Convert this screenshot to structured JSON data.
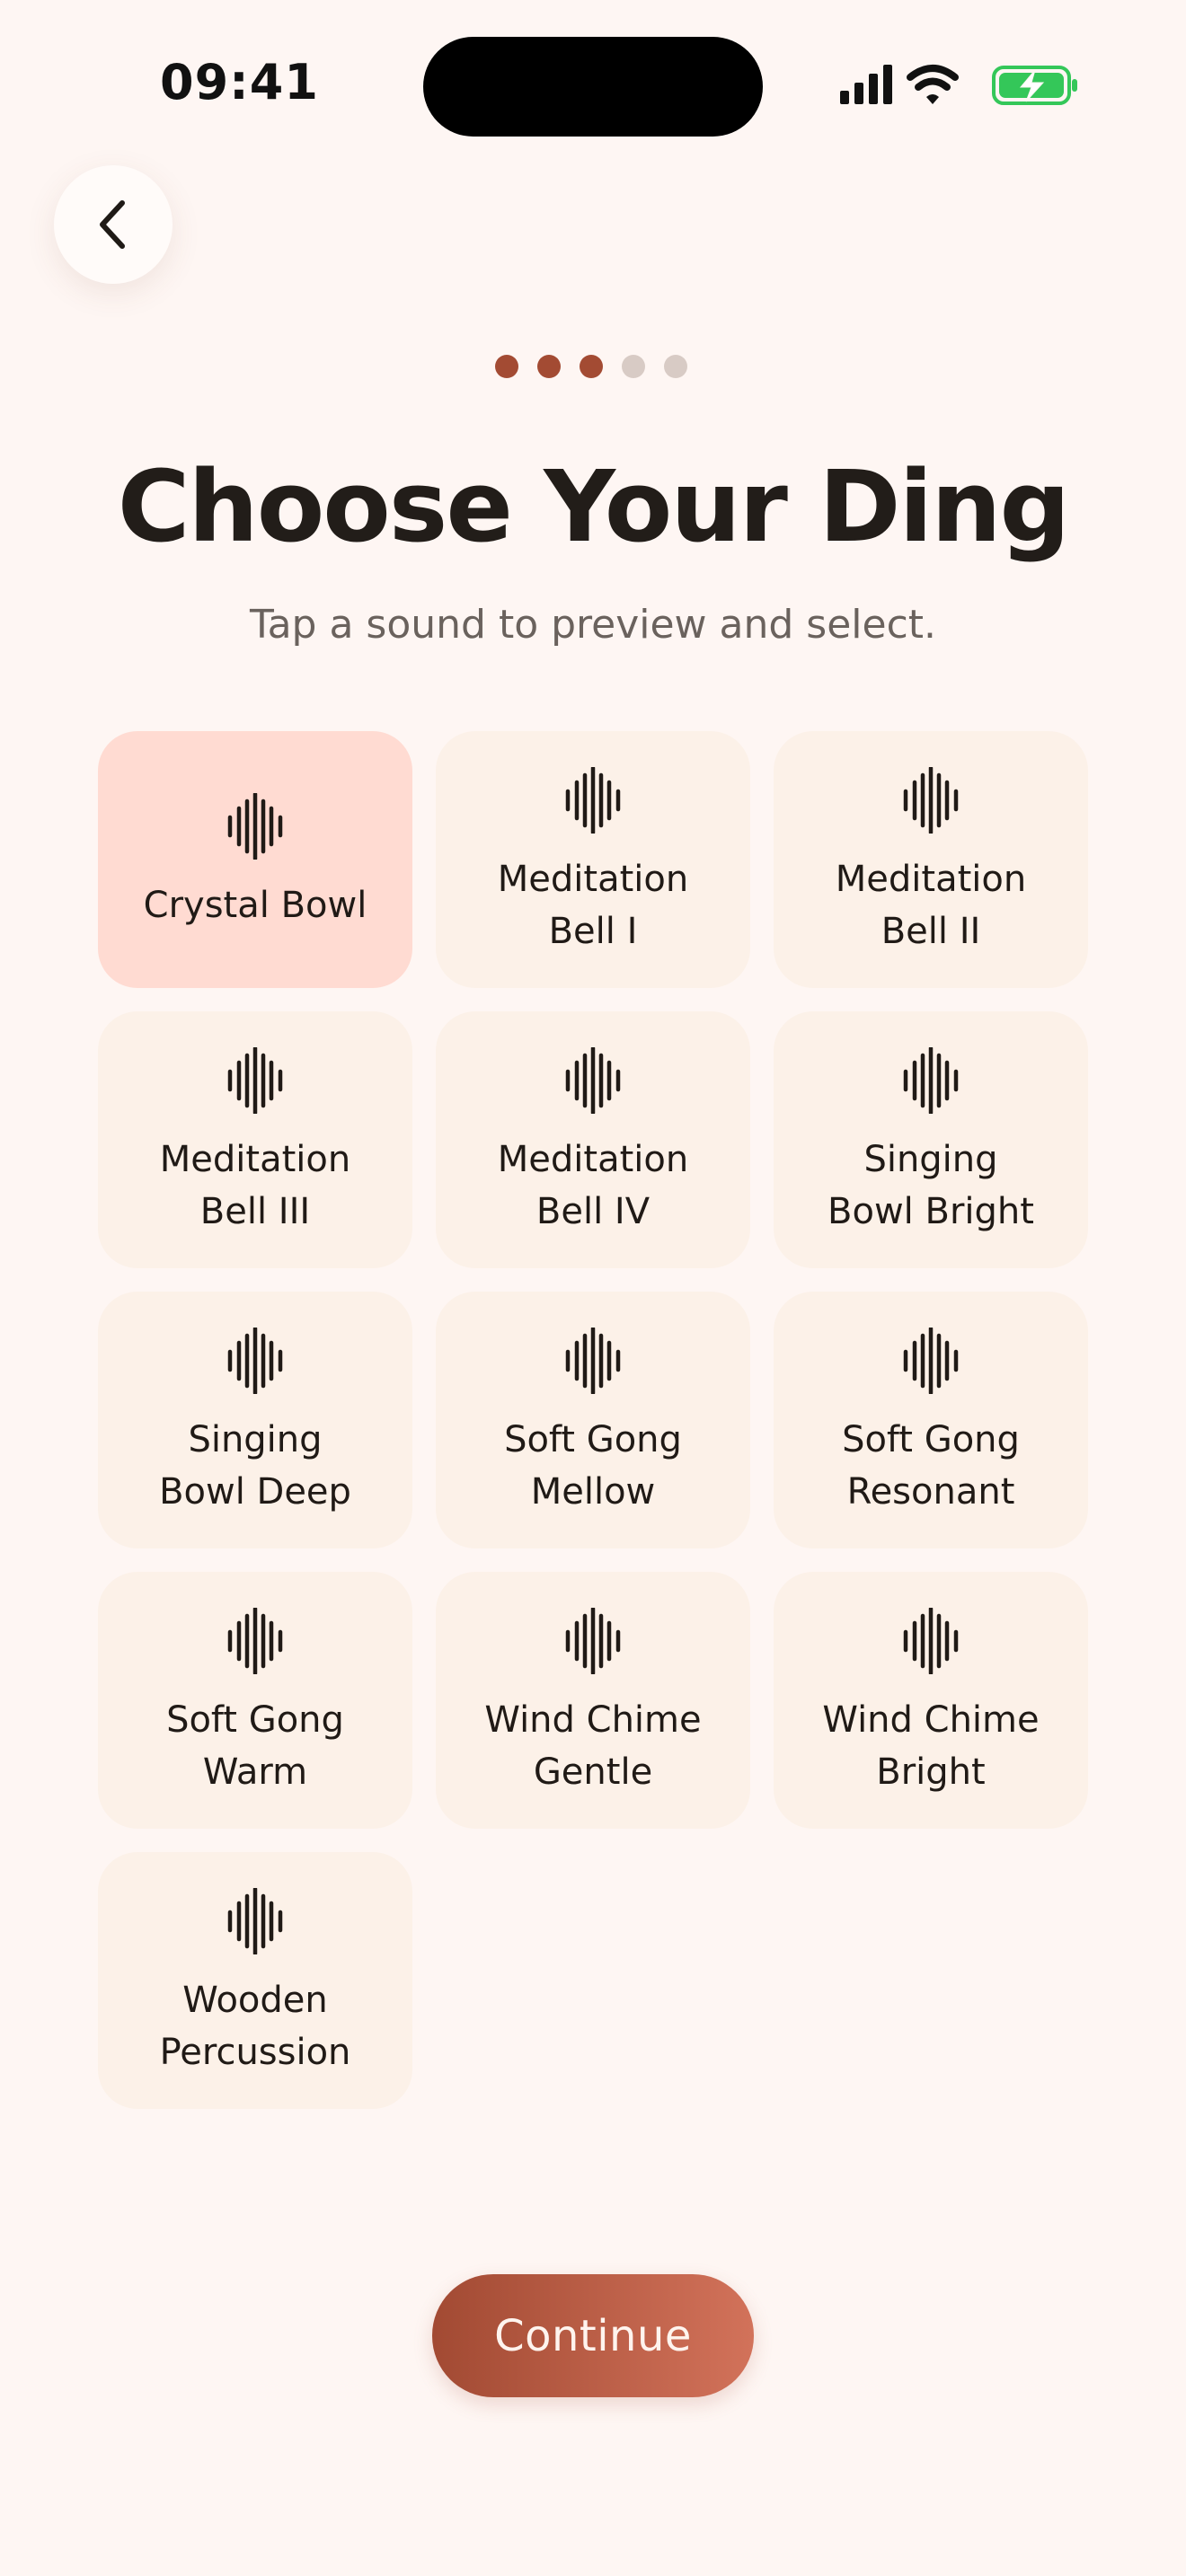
{
  "status_bar": {
    "time": "09:41"
  },
  "progress": {
    "total_steps": 5,
    "completed_steps": 3,
    "active_color": "#A34B33",
    "inactive_color": "#D8CBC5"
  },
  "header": {
    "back_icon": "chevron-left-icon",
    "title": "Choose Your Ding",
    "subtitle": "Tap a sound to preview and select."
  },
  "sounds": [
    {
      "label": "Crystal Bowl",
      "selected": true,
      "icon": "sound-wave-icon"
    },
    {
      "label": "Meditation\nBell I",
      "selected": false,
      "icon": "sound-wave-icon"
    },
    {
      "label": "Meditation\nBell II",
      "selected": false,
      "icon": "sound-wave-icon"
    },
    {
      "label": "Meditation\nBell III",
      "selected": false,
      "icon": "sound-wave-icon"
    },
    {
      "label": "Meditation\nBell IV",
      "selected": false,
      "icon": "sound-wave-icon"
    },
    {
      "label": "Singing\nBowl Bright",
      "selected": false,
      "icon": "sound-wave-icon"
    },
    {
      "label": "Singing\nBowl Deep",
      "selected": false,
      "icon": "sound-wave-icon"
    },
    {
      "label": "Soft Gong\nMellow",
      "selected": false,
      "icon": "sound-wave-icon"
    },
    {
      "label": "Soft Gong\nResonant",
      "selected": false,
      "icon": "sound-wave-icon"
    },
    {
      "label": "Soft Gong\nWarm",
      "selected": false,
      "icon": "sound-wave-icon"
    },
    {
      "label": "Wind Chime\nGentle",
      "selected": false,
      "icon": "sound-wave-icon"
    },
    {
      "label": "Wind Chime\nBright",
      "selected": false,
      "icon": "sound-wave-icon"
    },
    {
      "label": "Wooden\nPercussion",
      "selected": false,
      "icon": "sound-wave-icon"
    }
  ],
  "colors": {
    "background": "#FEF6F3",
    "tile": "#FCF1E8",
    "tile_selected": "#FFDBD2",
    "accent": "#A24A33"
  },
  "footer": {
    "continue_label": "Continue"
  }
}
